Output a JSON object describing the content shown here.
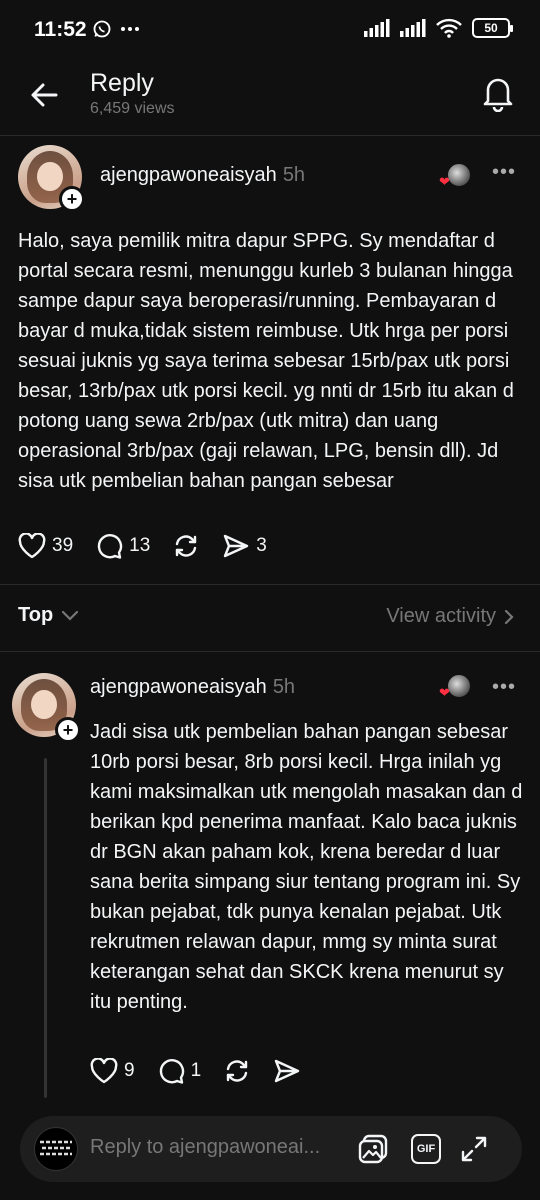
{
  "status_bar": {
    "time": "11:52",
    "battery": "50",
    "icons": [
      "whatsapp-icon",
      "more-dots-icon",
      "signal-icon",
      "signal-icon",
      "wifi-icon",
      "battery-icon"
    ]
  },
  "header": {
    "title": "Reply",
    "views": "6,459 views"
  },
  "main_post": {
    "username": "ajengpawoneaisyah",
    "time": "5h",
    "text": "Halo, saya pemilik mitra dapur SPPG. Sy mendaftar d portal secara resmi, menunggu kurleb 3 bulanan hingga sampe dapur saya beroperasi/running. Pembayaran d bayar d muka,tidak sistem reimbuse. Utk hrga per porsi sesuai juknis yg saya terima sebesar 15rb/pax utk porsi besar, 13rb/pax utk porsi kecil. yg nnti dr 15rb itu akan d potong uang sewa 2rb/pax (utk mitra)  dan uang operasional 3rb/pax (gaji relawan, LPG, bensin dll). Jd sisa utk pembelian bahan pangan sebesar",
    "likes": "39",
    "comments": "13",
    "shares": "3"
  },
  "sort": {
    "label": "Top",
    "view_activity": "View activity"
  },
  "reply_post": {
    "username": "ajengpawoneaisyah",
    "time": "5h",
    "text": "Jadi sisa utk pembelian bahan pangan sebesar 10rb porsi besar, 8rb porsi kecil. Hrga inilah  yg kami maksimalkan utk mengolah masakan dan d berikan kpd penerima manfaat. Kalo baca juknis dr BGN akan paham kok, krena beredar d luar sana berita simpang siur tentang program ini. Sy bukan pejabat, tdk punya kenalan pejabat. Utk rekrutmen relawan dapur, mmg sy minta surat keterangan sehat dan SKCK krena menurut sy itu penting.",
    "likes": "9",
    "comments": "1"
  },
  "composer": {
    "placeholder": "Reply to ajengpawoneai...",
    "gif_label": "GIF"
  }
}
